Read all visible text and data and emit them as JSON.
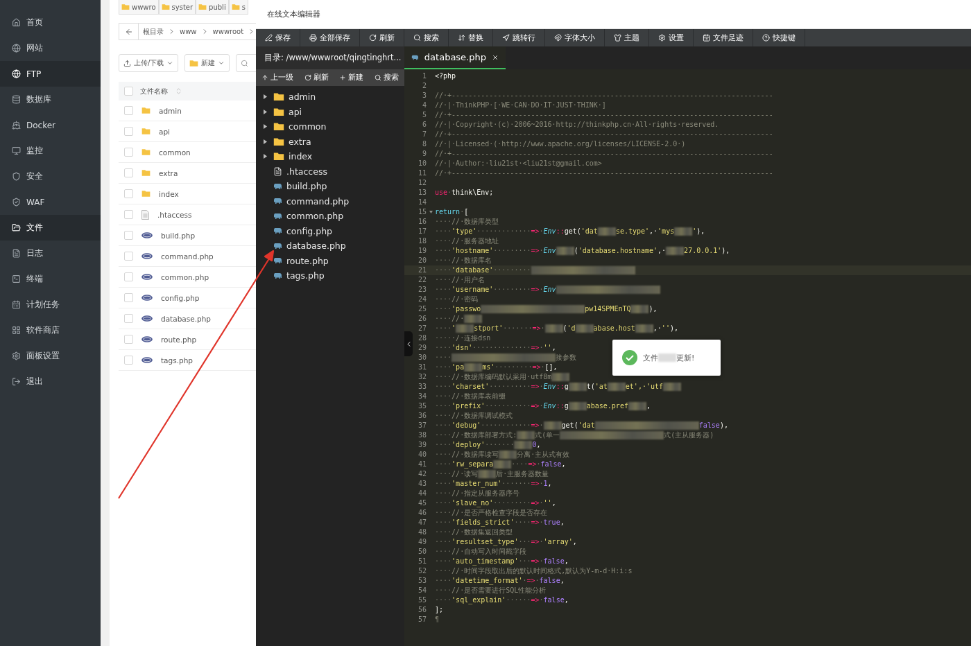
{
  "sidebar": {
    "items": [
      {
        "label": "首页",
        "selected": false
      },
      {
        "label": "网站",
        "selected": false
      },
      {
        "label": "FTP",
        "selected": true
      },
      {
        "label": "数据库",
        "selected": false
      },
      {
        "label": "Docker",
        "selected": false
      },
      {
        "label": "监控",
        "selected": false
      },
      {
        "label": "安全",
        "selected": false
      },
      {
        "label": "WAF",
        "selected": false
      },
      {
        "label": "文件",
        "selected": true
      },
      {
        "label": "日志",
        "selected": false
      },
      {
        "label": "终端",
        "selected": false
      },
      {
        "label": "计划任务",
        "selected": false
      },
      {
        "label": "软件商店",
        "selected": false
      },
      {
        "label": "面板设置",
        "selected": false
      },
      {
        "label": "退出",
        "selected": false
      }
    ]
  },
  "file_manager": {
    "folder_tabs": [
      "wwwro",
      "syster",
      "publi",
      "s"
    ],
    "breadcrumb": [
      "根目录",
      "www",
      "wwwroot"
    ],
    "buttons": [
      "上传/下载",
      "新建"
    ],
    "header": {
      "label": "文件名称",
      "checked": false
    },
    "rows": [
      {
        "name": "admin",
        "kind": "folder",
        "checked": false
      },
      {
        "name": "api",
        "kind": "folder",
        "checked": false
      },
      {
        "name": "common",
        "kind": "folder",
        "checked": false
      },
      {
        "name": "extra",
        "kind": "folder",
        "checked": false
      },
      {
        "name": "index",
        "kind": "folder",
        "checked": false
      },
      {
        "name": ".htaccess",
        "kind": "file",
        "checked": false
      },
      {
        "name": "build.php",
        "kind": "php",
        "checked": false
      },
      {
        "name": "command.php",
        "kind": "php",
        "checked": false
      },
      {
        "name": "common.php",
        "kind": "php",
        "checked": false
      },
      {
        "name": "config.php",
        "kind": "php",
        "checked": false
      },
      {
        "name": "database.php",
        "kind": "php",
        "checked": false
      },
      {
        "name": "route.php",
        "kind": "php",
        "checked": false
      },
      {
        "name": "tags.php",
        "kind": "php",
        "checked": false
      }
    ]
  },
  "editor": {
    "title": "在线文本编辑器",
    "toolbar": [
      "保存",
      "全部保存",
      "刷新",
      "搜索",
      "替换",
      "跳转行",
      "字体大小",
      "主题",
      "设置",
      "文件足迹",
      "快捷键"
    ],
    "directory": "目录: /www/wwwroot/qingtinghrt...",
    "tabs": [
      {
        "label": "database.php",
        "selected": true
      }
    ],
    "tree_toolbar": [
      "上一级",
      "刷新",
      "新建",
      "搜索"
    ],
    "tree": [
      {
        "name": "admin",
        "kind": "folder",
        "expanded": false
      },
      {
        "name": "api",
        "kind": "folder",
        "expanded": false
      },
      {
        "name": "common",
        "kind": "folder",
        "expanded": false
      },
      {
        "name": "extra",
        "kind": "folder",
        "expanded": false
      },
      {
        "name": "index",
        "kind": "folder",
        "expanded": false
      },
      {
        "name": ".htaccess",
        "kind": "file"
      },
      {
        "name": "build.php",
        "kind": "php"
      },
      {
        "name": "command.php",
        "kind": "php"
      },
      {
        "name": "common.php",
        "kind": "php"
      },
      {
        "name": "config.php",
        "kind": "php"
      },
      {
        "name": "database.php",
        "kind": "php"
      },
      {
        "name": "route.php",
        "kind": "php"
      },
      {
        "name": "tags.php",
        "kind": "php"
      }
    ],
    "code": [
      {
        "n": "1",
        "active": false,
        "fold": false,
        "tokens": [
          {
            "kind": "plain",
            "text": "<?php"
          }
        ]
      },
      {
        "n": "2",
        "active": false,
        "fold": false
      },
      {
        "n": "3",
        "active": false,
        "fold": false,
        "tokens": [
          {
            "kind": "cmt",
            "text": "//·+-----------------------------------------------------------------------------"
          }
        ]
      },
      {
        "n": "4",
        "active": false,
        "fold": false,
        "tokens": [
          {
            "kind": "cmt",
            "text": "//·|·ThinkPHP·[·WE·CAN·DO·IT·JUST·THINK·]"
          }
        ]
      },
      {
        "n": "5",
        "active": false,
        "fold": false,
        "tokens": [
          {
            "kind": "cmt",
            "text": "//·+-----------------------------------------------------------------------------"
          }
        ]
      },
      {
        "n": "6",
        "active": false,
        "fold": false,
        "tokens": [
          {
            "kind": "cmt",
            "text": "//·|·Copyright·(c)·2006~2016·http://thinkphp.cn·All·rights·reserved."
          }
        ]
      },
      {
        "n": "7",
        "active": false,
        "fold": false,
        "tokens": [
          {
            "kind": "cmt",
            "text": "//·+-----------------------------------------------------------------------------"
          }
        ]
      },
      {
        "n": "8",
        "active": false,
        "fold": false,
        "tokens": [
          {
            "kind": "cmt",
            "text": "//·|·Licensed·(·http://www.apache.org/licenses/LICENSE-2.0·)"
          }
        ]
      },
      {
        "n": "9",
        "active": false,
        "fold": false,
        "tokens": [
          {
            "kind": "cmt",
            "text": "//·+-----------------------------------------------------------------------------"
          }
        ]
      },
      {
        "n": "10",
        "active": false,
        "fold": false,
        "tokens": [
          {
            "kind": "cmt",
            "text": "//·|·Author:·liu21st·<liu21st@gmail.com>"
          }
        ]
      },
      {
        "n": "11",
        "active": false,
        "fold": false,
        "tokens": [
          {
            "kind": "cmt",
            "text": "//·+-----------------------------------------------------------------------------"
          }
        ]
      },
      {
        "n": "12",
        "active": false,
        "fold": false
      },
      {
        "n": "13",
        "active": false,
        "fold": false,
        "tokens": [
          {
            "kind": "kw",
            "text": "use"
          },
          {
            "kind": "ws",
            "text": "·"
          },
          {
            "kind": "plain",
            "text": "think\\Env;"
          }
        ]
      },
      {
        "n": "14",
        "active": false,
        "fold": false
      },
      {
        "n": "15",
        "active": false,
        "fold": true,
        "tokens": [
          {
            "kind": "kw2",
            "text": "return"
          },
          {
            "kind": "ws",
            "text": "·"
          },
          {
            "kind": "plain",
            "text": "["
          }
        ]
      },
      {
        "n": "16",
        "active": false,
        "fold": false,
        "tokens": [
          {
            "kind": "ws",
            "text": "····"
          },
          {
            "kind": "cmt",
            "text": "//·数据库类型"
          }
        ]
      },
      {
        "n": "17",
        "active": false,
        "fold": false,
        "tokens": [
          {
            "kind": "ws",
            "text": "····"
          },
          {
            "kind": "str",
            "text": "'type'"
          },
          {
            "kind": "ws",
            "text": "·············"
          },
          {
            "kind": "op",
            "text": "=>"
          },
          {
            "kind": "ws",
            "text": "·"
          },
          {
            "kind": "cls",
            "text": "Env"
          },
          {
            "kind": "op",
            "text": "::"
          },
          {
            "kind": "plain",
            "text": "get("
          },
          {
            "kind": "str",
            "text": "'dat"
          },
          {
            "kind": "blur"
          },
          {
            "kind": "str",
            "text": "se.type'"
          },
          {
            "kind": "plain",
            "text": ",·"
          },
          {
            "kind": "str",
            "text": "'mys"
          },
          {
            "kind": "blur"
          },
          {
            "kind": "str",
            "text": "'"
          },
          {
            "kind": "plain",
            "text": "),"
          }
        ]
      },
      {
        "n": "18",
        "active": false,
        "fold": false,
        "tokens": [
          {
            "kind": "ws",
            "text": "····"
          },
          {
            "kind": "cmt",
            "text": "//·服务器地址"
          }
        ]
      },
      {
        "n": "19",
        "active": false,
        "fold": false,
        "tokens": [
          {
            "kind": "ws",
            "text": "····"
          },
          {
            "kind": "str",
            "text": "'hostname'"
          },
          {
            "kind": "ws",
            "text": "·········"
          },
          {
            "kind": "op",
            "text": "=>"
          },
          {
            "kind": "ws",
            "text": "·"
          },
          {
            "kind": "cls",
            "text": "Env"
          },
          {
            "kind": "blur"
          },
          {
            "kind": "plain",
            "text": "("
          },
          {
            "kind": "str",
            "text": "'database.hostname'"
          },
          {
            "kind": "plain",
            "text": ",·"
          },
          {
            "kind": "blur"
          },
          {
            "kind": "str",
            "text": "27.0.0.1'"
          },
          {
            "kind": "plain",
            "text": "),"
          }
        ]
      },
      {
        "n": "20",
        "active": false,
        "fold": false,
        "tokens": [
          {
            "kind": "ws",
            "text": "····"
          },
          {
            "kind": "cmt",
            "text": "//·数据库名"
          }
        ]
      },
      {
        "n": "21",
        "active": true,
        "fold": false,
        "tokens": [
          {
            "kind": "ws",
            "text": "····"
          },
          {
            "kind": "str",
            "text": "'database'"
          },
          {
            "kind": "ws",
            "text": "·········"
          },
          {
            "kind": "blur_long"
          }
        ]
      },
      {
        "n": "22",
        "active": false,
        "fold": false,
        "tokens": [
          {
            "kind": "ws",
            "text": "····"
          },
          {
            "kind": "cmt",
            "text": "//·用户名"
          }
        ]
      },
      {
        "n": "23",
        "active": false,
        "fold": false,
        "tokens": [
          {
            "kind": "ws",
            "text": "····"
          },
          {
            "kind": "str",
            "text": "'username'"
          },
          {
            "kind": "ws",
            "text": "·········"
          },
          {
            "kind": "op",
            "text": "=>"
          },
          {
            "kind": "ws",
            "text": "·"
          },
          {
            "kind": "cls",
            "text": "Env"
          },
          {
            "kind": "blur_long"
          }
        ]
      },
      {
        "n": "24",
        "active": false,
        "fold": false,
        "tokens": [
          {
            "kind": "ws",
            "text": "····"
          },
          {
            "kind": "cmt",
            "text": "//·密码"
          }
        ]
      },
      {
        "n": "25",
        "active": false,
        "fold": false,
        "tokens": [
          {
            "kind": "ws",
            "text": "····"
          },
          {
            "kind": "str",
            "text": "'passwo"
          },
          {
            "kind": "blur_long"
          },
          {
            "kind": "str",
            "text": "pw14SPMEnTQ"
          },
          {
            "kind": "blur"
          },
          {
            "kind": "plain",
            "text": "),"
          }
        ]
      },
      {
        "n": "26",
        "active": false,
        "fold": false,
        "tokens": [
          {
            "kind": "ws",
            "text": "····"
          },
          {
            "kind": "cmt",
            "text": "//·"
          },
          {
            "kind": "blur"
          }
        ]
      },
      {
        "n": "27",
        "active": false,
        "fold": false,
        "tokens": [
          {
            "kind": "ws",
            "text": "····"
          },
          {
            "kind": "str",
            "text": "'"
          },
          {
            "kind": "blur"
          },
          {
            "kind": "str",
            "text": "stport'"
          },
          {
            "kind": "ws",
            "text": "·······"
          },
          {
            "kind": "op",
            "text": "=>"
          },
          {
            "kind": "ws",
            "text": "·"
          },
          {
            "kind": "blur"
          },
          {
            "kind": "plain",
            "text": "("
          },
          {
            "kind": "str",
            "text": "'d"
          },
          {
            "kind": "blur"
          },
          {
            "kind": "str",
            "text": "abase.host"
          },
          {
            "kind": "blur"
          },
          {
            "kind": "plain",
            "text": ",·"
          },
          {
            "kind": "str",
            "text": "''"
          },
          {
            "kind": "plain",
            "text": "),"
          }
        ]
      },
      {
        "n": "28",
        "active": false,
        "fold": false,
        "tokens": [
          {
            "kind": "ws",
            "text": "····"
          },
          {
            "kind": "cmt",
            "text": "·/·连接dsn"
          }
        ]
      },
      {
        "n": "29",
        "active": false,
        "fold": false,
        "tokens": [
          {
            "kind": "ws",
            "text": "····"
          },
          {
            "kind": "str",
            "text": "'dsn'"
          },
          {
            "kind": "ws",
            "text": "··············"
          },
          {
            "kind": "op",
            "text": "=>"
          },
          {
            "kind": "ws",
            "text": "·"
          },
          {
            "kind": "str",
            "text": "''"
          },
          {
            "kind": "plain",
            "text": ","
          }
        ]
      },
      {
        "n": "30",
        "active": false,
        "fold": false,
        "tokens": [
          {
            "kind": "ws",
            "text": "····"
          },
          {
            "kind": "blur_long"
          },
          {
            "kind": "cmt",
            "text": "接参数"
          }
        ]
      },
      {
        "n": "31",
        "active": false,
        "fold": false,
        "tokens": [
          {
            "kind": "ws",
            "text": "····"
          },
          {
            "kind": "str",
            "text": "'pa"
          },
          {
            "kind": "blur"
          },
          {
            "kind": "str",
            "text": "ms'"
          },
          {
            "kind": "ws",
            "text": "·········"
          },
          {
            "kind": "op",
            "text": "=>"
          },
          {
            "kind": "ws",
            "text": "·"
          },
          {
            "kind": "plain",
            "text": "[],"
          }
        ]
      },
      {
        "n": "32",
        "active": false,
        "fold": false,
        "tokens": [
          {
            "kind": "ws",
            "text": "····"
          },
          {
            "kind": "cmt",
            "text": "//·数据库编码默认采用·utf8m"
          },
          {
            "kind": "blur"
          }
        ]
      },
      {
        "n": "33",
        "active": false,
        "fold": false,
        "tokens": [
          {
            "kind": "ws",
            "text": "····"
          },
          {
            "kind": "str",
            "text": "'charset'"
          },
          {
            "kind": "ws",
            "text": "··········"
          },
          {
            "kind": "op",
            "text": "=>"
          },
          {
            "kind": "ws",
            "text": "·"
          },
          {
            "kind": "cls",
            "text": "Env"
          },
          {
            "kind": "op",
            "text": "::"
          },
          {
            "kind": "plain",
            "text": "g"
          },
          {
            "kind": "blur"
          },
          {
            "kind": "plain",
            "text": "t("
          },
          {
            "kind": "str",
            "text": "'at"
          },
          {
            "kind": "blur"
          },
          {
            "kind": "str",
            "text": "et',·'utf"
          },
          {
            "kind": "blur"
          }
        ]
      },
      {
        "n": "34",
        "active": false,
        "fold": false,
        "tokens": [
          {
            "kind": "ws",
            "text": "····"
          },
          {
            "kind": "cmt",
            "text": "//·数据库表前缀"
          }
        ]
      },
      {
        "n": "35",
        "active": false,
        "fold": false,
        "tokens": [
          {
            "kind": "ws",
            "text": "····"
          },
          {
            "kind": "str",
            "text": "'prefix'"
          },
          {
            "kind": "ws",
            "text": "···········"
          },
          {
            "kind": "op",
            "text": "=>"
          },
          {
            "kind": "ws",
            "text": "·"
          },
          {
            "kind": "cls",
            "text": "Env"
          },
          {
            "kind": "op",
            "text": "::"
          },
          {
            "kind": "plain",
            "text": "g"
          },
          {
            "kind": "blur"
          },
          {
            "kind": "str",
            "text": "abase.pref"
          },
          {
            "kind": "blur"
          },
          {
            "kind": "plain",
            "text": ","
          }
        ]
      },
      {
        "n": "36",
        "active": false,
        "fold": false,
        "tokens": [
          {
            "kind": "ws",
            "text": "····"
          },
          {
            "kind": "cmt",
            "text": "//·数据库调试模式"
          }
        ]
      },
      {
        "n": "37",
        "active": false,
        "fold": false,
        "tokens": [
          {
            "kind": "ws",
            "text": "····"
          },
          {
            "kind": "str",
            "text": "'debug'"
          },
          {
            "kind": "ws",
            "text": "············"
          },
          {
            "kind": "op",
            "text": "=>"
          },
          {
            "kind": "ws",
            "text": "·"
          },
          {
            "kind": "blur"
          },
          {
            "kind": "plain",
            "text": "get("
          },
          {
            "kind": "str",
            "text": "'dat"
          },
          {
            "kind": "blur_long"
          },
          {
            "kind": "num",
            "text": "false"
          },
          {
            "kind": "plain",
            "text": "),"
          }
        ]
      },
      {
        "n": "38",
        "active": false,
        "fold": false,
        "tokens": [
          {
            "kind": "ws",
            "text": "····"
          },
          {
            "kind": "cmt",
            "text": "//·数据库部署方式:"
          },
          {
            "kind": "blur"
          },
          {
            "kind": "cmt",
            "text": "式(单一"
          },
          {
            "kind": "blur_long"
          },
          {
            "kind": "cmt",
            "text": "式(主从服务器)"
          }
        ]
      },
      {
        "n": "39",
        "active": false,
        "fold": false,
        "tokens": [
          {
            "kind": "ws",
            "text": "····"
          },
          {
            "kind": "str",
            "text": "'deploy'"
          },
          {
            "kind": "ws",
            "text": "·······"
          },
          {
            "kind": "blur"
          },
          {
            "kind": "num",
            "text": "0"
          },
          {
            "kind": "plain",
            "text": ","
          }
        ]
      },
      {
        "n": "40",
        "active": false,
        "fold": false,
        "tokens": [
          {
            "kind": "ws",
            "text": "····"
          },
          {
            "kind": "cmt",
            "text": "//·数据库读写"
          },
          {
            "kind": "blur"
          },
          {
            "kind": "cmt",
            "text": "分离·主从式有效"
          }
        ]
      },
      {
        "n": "41",
        "active": false,
        "fold": false,
        "tokens": [
          {
            "kind": "ws",
            "text": "····"
          },
          {
            "kind": "str",
            "text": "'rw_separa"
          },
          {
            "kind": "blur"
          },
          {
            "kind": "ws",
            "text": "····"
          },
          {
            "kind": "op",
            "text": "=>"
          },
          {
            "kind": "ws",
            "text": "·"
          },
          {
            "kind": "num",
            "text": "false"
          },
          {
            "kind": "plain",
            "text": ","
          }
        ]
      },
      {
        "n": "42",
        "active": false,
        "fold": false,
        "tokens": [
          {
            "kind": "ws",
            "text": "····"
          },
          {
            "kind": "cmt",
            "text": "//·读写"
          },
          {
            "kind": "blur"
          },
          {
            "kind": "cmt",
            "text": "后·主服务器数量"
          }
        ]
      },
      {
        "n": "43",
        "active": false,
        "fold": false,
        "tokens": [
          {
            "kind": "ws",
            "text": "····"
          },
          {
            "kind": "str",
            "text": "'master_num'"
          },
          {
            "kind": "ws",
            "text": "·······"
          },
          {
            "kind": "op",
            "text": "=>"
          },
          {
            "kind": "ws",
            "text": "·"
          },
          {
            "kind": "num",
            "text": "1"
          },
          {
            "kind": "plain",
            "text": ","
          }
        ]
      },
      {
        "n": "44",
        "active": false,
        "fold": false,
        "tokens": [
          {
            "kind": "ws",
            "text": "····"
          },
          {
            "kind": "cmt",
            "text": "//·指定从服务器序号"
          }
        ]
      },
      {
        "n": "45",
        "active": false,
        "fold": false,
        "tokens": [
          {
            "kind": "ws",
            "text": "····"
          },
          {
            "kind": "str",
            "text": "'slave_no'"
          },
          {
            "kind": "ws",
            "text": "·········"
          },
          {
            "kind": "op",
            "text": "=>"
          },
          {
            "kind": "ws",
            "text": "·"
          },
          {
            "kind": "str",
            "text": "''"
          },
          {
            "kind": "plain",
            "text": ","
          }
        ]
      },
      {
        "n": "46",
        "active": false,
        "fold": false,
        "tokens": [
          {
            "kind": "ws",
            "text": "····"
          },
          {
            "kind": "cmt",
            "text": "//·是否严格检查字段是否存在"
          }
        ]
      },
      {
        "n": "47",
        "active": false,
        "fold": false,
        "tokens": [
          {
            "kind": "ws",
            "text": "····"
          },
          {
            "kind": "str",
            "text": "'fields_strict'"
          },
          {
            "kind": "ws",
            "text": "····"
          },
          {
            "kind": "op",
            "text": "=>"
          },
          {
            "kind": "ws",
            "text": "·"
          },
          {
            "kind": "num",
            "text": "true"
          },
          {
            "kind": "plain",
            "text": ","
          }
        ]
      },
      {
        "n": "48",
        "active": false,
        "fold": false,
        "tokens": [
          {
            "kind": "ws",
            "text": "····"
          },
          {
            "kind": "cmt",
            "text": "//·数据集返回类型"
          }
        ]
      },
      {
        "n": "49",
        "active": false,
        "fold": false,
        "tokens": [
          {
            "kind": "ws",
            "text": "····"
          },
          {
            "kind": "str",
            "text": "'resultset_type'"
          },
          {
            "kind": "ws",
            "text": "···"
          },
          {
            "kind": "op",
            "text": "=>"
          },
          {
            "kind": "ws",
            "text": "·"
          },
          {
            "kind": "str",
            "text": "'array'"
          },
          {
            "kind": "plain",
            "text": ","
          }
        ]
      },
      {
        "n": "50",
        "active": false,
        "fold": false,
        "tokens": [
          {
            "kind": "ws",
            "text": "····"
          },
          {
            "kind": "cmt",
            "text": "//·自动写入时间戳字段"
          }
        ]
      },
      {
        "n": "51",
        "active": false,
        "fold": false,
        "tokens": [
          {
            "kind": "ws",
            "text": "····"
          },
          {
            "kind": "str",
            "text": "'auto_timestamp'"
          },
          {
            "kind": "ws",
            "text": "···"
          },
          {
            "kind": "op",
            "text": "=>"
          },
          {
            "kind": "ws",
            "text": "·"
          },
          {
            "kind": "num",
            "text": "false"
          },
          {
            "kind": "plain",
            "text": ","
          }
        ]
      },
      {
        "n": "52",
        "active": false,
        "fold": false,
        "tokens": [
          {
            "kind": "ws",
            "text": "····"
          },
          {
            "kind": "cmt",
            "text": "//·时间字段取出后的默认时间格式,默认为Y-m-d·H:i:s"
          }
        ]
      },
      {
        "n": "53",
        "active": false,
        "fold": false,
        "tokens": [
          {
            "kind": "ws",
            "text": "····"
          },
          {
            "kind": "str",
            "text": "'datetime_format'"
          },
          {
            "kind": "ws",
            "text": "·"
          },
          {
            "kind": "op",
            "text": "=>"
          },
          {
            "kind": "ws",
            "text": "·"
          },
          {
            "kind": "num",
            "text": "false"
          },
          {
            "kind": "plain",
            "text": ","
          }
        ]
      },
      {
        "n": "54",
        "active": false,
        "fold": false,
        "tokens": [
          {
            "kind": "ws",
            "text": "····"
          },
          {
            "kind": "cmt",
            "text": "//·是否需要进行SQL性能分析"
          }
        ]
      },
      {
        "n": "55",
        "active": false,
        "fold": false,
        "tokens": [
          {
            "kind": "ws",
            "text": "····"
          },
          {
            "kind": "str",
            "text": "'sql_explain'"
          },
          {
            "kind": "ws",
            "text": "······"
          },
          {
            "kind": "op",
            "text": "=>"
          },
          {
            "kind": "ws",
            "text": "·"
          },
          {
            "kind": "num",
            "text": "false"
          },
          {
            "kind": "plain",
            "text": ","
          }
        ]
      },
      {
        "n": "56",
        "active": false,
        "fold": false,
        "tokens": [
          {
            "kind": "plain",
            "text": "];"
          }
        ]
      },
      {
        "n": "57",
        "active": false,
        "fold": false,
        "tokens": [
          {
            "kind": "ws",
            "text": "¶"
          }
        ]
      }
    ],
    "toast": {
      "parts": [
        {
          "kind": "text",
          "text": "文件"
        },
        {
          "kind": "blur"
        },
        {
          "kind": "text",
          "text": "更新!"
        }
      ]
    }
  }
}
